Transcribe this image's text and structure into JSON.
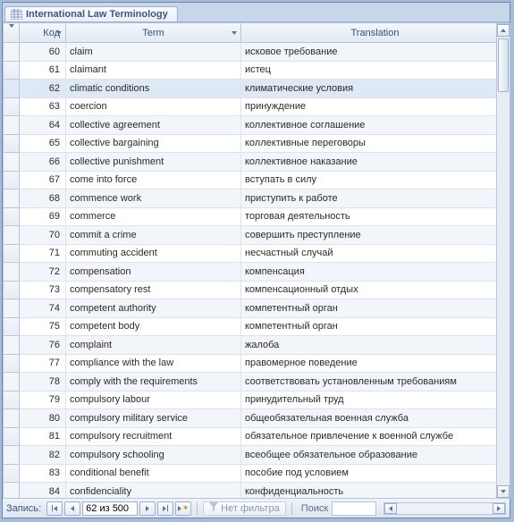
{
  "tab": {
    "title": "International Law Terminology"
  },
  "columns": {
    "code": "Код",
    "term": "Term",
    "translation": "Translation"
  },
  "rows": [
    {
      "code": 60,
      "term": "claim",
      "translation": "исковое требование"
    },
    {
      "code": 61,
      "term": "claimant",
      "translation": "истец"
    },
    {
      "code": 62,
      "term": "climatic conditions",
      "translation": "климатические условия"
    },
    {
      "code": 63,
      "term": "coercion",
      "translation": "принуждение"
    },
    {
      "code": 64,
      "term": "collective agreement",
      "translation": "коллективное соглашение"
    },
    {
      "code": 65,
      "term": "collective bargaining",
      "translation": "коллективные переговоры"
    },
    {
      "code": 66,
      "term": "collective punishment",
      "translation": "коллективное наказание"
    },
    {
      "code": 67,
      "term": "come into force",
      "translation": "вступать в силу"
    },
    {
      "code": 68,
      "term": "commence work",
      "translation": "приступить к работе"
    },
    {
      "code": 69,
      "term": "commerce",
      "translation": "торговая деятельность"
    },
    {
      "code": 70,
      "term": "commit a crime",
      "translation": "совершить преступление"
    },
    {
      "code": 71,
      "term": "commuting accident",
      "translation": "несчастный случай"
    },
    {
      "code": 72,
      "term": "compensation",
      "translation": "компенсация"
    },
    {
      "code": 73,
      "term": "compensatory rest",
      "translation": "компенсационный отдых"
    },
    {
      "code": 74,
      "term": "competent authority",
      "translation": "компетентный орган"
    },
    {
      "code": 75,
      "term": "competent body",
      "translation": "компетентный орган"
    },
    {
      "code": 76,
      "term": "complaint",
      "translation": "жалоба"
    },
    {
      "code": 77,
      "term": "compliance with the law",
      "translation": "правомерное поведение"
    },
    {
      "code": 78,
      "term": "comply with the requirements",
      "translation": "соответствовать установленным требованиям"
    },
    {
      "code": 79,
      "term": "compulsory labour",
      "translation": "принудительный труд"
    },
    {
      "code": 80,
      "term": "compulsory military service",
      "translation": "общеобязательная военная служба"
    },
    {
      "code": 81,
      "term": "compulsory recruitment",
      "translation": "обязательное привлечение к военной службе"
    },
    {
      "code": 82,
      "term": "compulsory schooling",
      "translation": "всеобщее обязательное образование"
    },
    {
      "code": 83,
      "term": "conditional benefit",
      "translation": "пособие под условием"
    },
    {
      "code": 84,
      "term": "confidenciality",
      "translation": "конфиденциальность"
    }
  ],
  "nav": {
    "record_label": "Запись:",
    "position": "62 из 500",
    "filter_label": "Нет фильтра",
    "search_label": "Поиск"
  },
  "selected_index": 2
}
